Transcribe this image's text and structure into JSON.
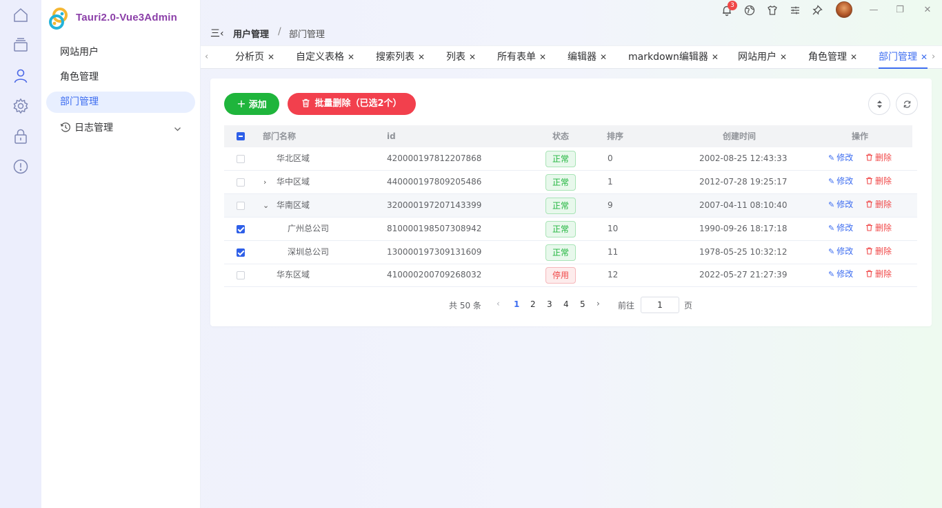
{
  "app": {
    "title": "Tauri2.0-Vue3Admin",
    "accent_color": "#3d6df0"
  },
  "rail": {
    "icons": [
      "home-icon",
      "layers-icon",
      "user-icon",
      "settings-icon",
      "lock-icon",
      "alert-circle-icon"
    ],
    "active": "user-icon"
  },
  "sidebar": {
    "items": [
      {
        "label": "网站用户"
      },
      {
        "label": "角色管理"
      },
      {
        "label": "部门管理",
        "active": true
      },
      {
        "label": "日志管理",
        "icon": "clock-icon",
        "expandable": true
      }
    ]
  },
  "topbar": {
    "notification_count": "3",
    "icons": [
      "bell-icon",
      "globe-icon",
      "shirt-icon",
      "sliders-icon",
      "pin-icon"
    ],
    "window_controls": [
      "minimize",
      "restore",
      "close"
    ]
  },
  "breadcrumb": {
    "collapse_glyph": "三‹",
    "items": [
      "用户管理",
      "部门管理"
    ],
    "separator": "/"
  },
  "tabs": [
    {
      "label": "分析页"
    },
    {
      "label": "自定义表格"
    },
    {
      "label": "搜索列表"
    },
    {
      "label": "列表"
    },
    {
      "label": "所有表单"
    },
    {
      "label": "编辑器"
    },
    {
      "label": "markdown编辑器"
    },
    {
      "label": "网站用户"
    },
    {
      "label": "角色管理"
    },
    {
      "label": "部门管理",
      "active": true
    }
  ],
  "toolbar": {
    "add_label": "添加",
    "batch_delete_label": "批量删除（已选2个）",
    "add_color": "#1fb53c",
    "delete_color": "#f2404d"
  },
  "table": {
    "columns": [
      "部门名称",
      "id",
      "状态",
      "排序",
      "创建时间",
      "操作"
    ],
    "rows": [
      {
        "name": "华北区域",
        "id": "420000197812207868",
        "status": "正常",
        "sort": "0",
        "created": "2002-08-25 12:43:33",
        "checked": false,
        "level": 0,
        "expander": ""
      },
      {
        "name": "华中区域",
        "id": "440000197809205486",
        "status": "正常",
        "sort": "1",
        "created": "2012-07-28 19:25:17",
        "checked": false,
        "level": 0,
        "expander": "›"
      },
      {
        "name": "华南区域",
        "id": "320000197207143399",
        "status": "正常",
        "sort": "9",
        "created": "2007-04-11 08:10:40",
        "checked": false,
        "level": 0,
        "expander": "⌄"
      },
      {
        "name": "广州总公司",
        "id": "810000198507308942",
        "status": "正常",
        "sort": "10",
        "created": "1990-09-26 18:17:18",
        "checked": true,
        "level": 1,
        "expander": ""
      },
      {
        "name": "深圳总公司",
        "id": "130000197309131609",
        "status": "正常",
        "sort": "11",
        "created": "1978-05-25 10:32:12",
        "checked": true,
        "level": 1,
        "expander": ""
      },
      {
        "name": "华东区域",
        "id": "410000200709268032",
        "status": "停用",
        "sort": "12",
        "created": "2022-05-27 21:27:39",
        "checked": false,
        "level": 0,
        "expander": ""
      }
    ],
    "edit_label": "修改",
    "delete_label": "删除"
  },
  "pagination": {
    "total_text": "共 50 条",
    "pages": [
      "1",
      "2",
      "3",
      "4",
      "5"
    ],
    "current_page": "1",
    "goto_prefix": "前往",
    "goto_value": "1",
    "goto_suffix": "页"
  }
}
